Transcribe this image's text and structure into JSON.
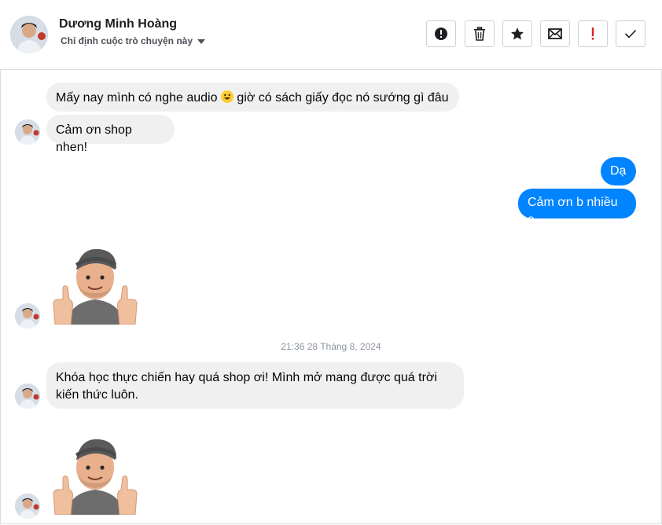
{
  "header": {
    "name": "Dương Minh Hoàng",
    "assign_label": "Chỉ định cuộc trò chuyện này"
  },
  "toolbar": {
    "icons": [
      "alert-icon",
      "trash-icon",
      "star-icon",
      "mail-icon",
      "exclamation-icon",
      "check-icon"
    ]
  },
  "messages": {
    "m1": "Mấy nay mình có nghe audio",
    "m1_tail": "giờ có sách giấy đọc nó sướng gì đâu",
    "m2": "Cảm ơn shop nhen!",
    "m3": "Dạ",
    "m4": "Cảm ơn b nhiều ạ",
    "timestamp": "21:36 28 Tháng 8, 2024",
    "m5_line1": "Khóa học thực chiến hay quá shop ơi! Mình mở mang được quá trời",
    "m5_line2": "kiến thức luôn."
  },
  "colors": {
    "outgoing": "#0084ff",
    "incoming": "#f0f0f0",
    "flag_red": "#e02020"
  }
}
